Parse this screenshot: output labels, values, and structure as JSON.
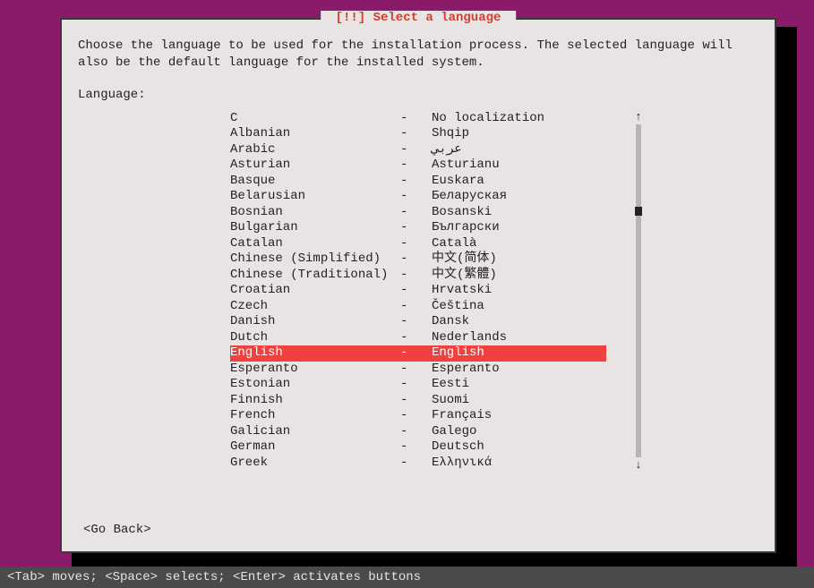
{
  "title": " [!!] Select a language ",
  "instructions": "Choose the language to be used for the installation process. The selected language will also be the default language for the installed system.",
  "label": "Language:",
  "dash": "-",
  "items": [
    {
      "name": "C",
      "native": "No localization"
    },
    {
      "name": "Albanian",
      "native": "Shqip"
    },
    {
      "name": "Arabic",
      "native": "عربي"
    },
    {
      "name": "Asturian",
      "native": "Asturianu"
    },
    {
      "name": "Basque",
      "native": "Euskara"
    },
    {
      "name": "Belarusian",
      "native": "Беларуская"
    },
    {
      "name": "Bosnian",
      "native": "Bosanski"
    },
    {
      "name": "Bulgarian",
      "native": "Български"
    },
    {
      "name": "Catalan",
      "native": "Català"
    },
    {
      "name": "Chinese (Simplified)",
      "native": "中文(简体)"
    },
    {
      "name": "Chinese (Traditional)",
      "native": "中文(繁體)"
    },
    {
      "name": "Croatian",
      "native": "Hrvatski"
    },
    {
      "name": "Czech",
      "native": "Čeština"
    },
    {
      "name": "Danish",
      "native": "Dansk"
    },
    {
      "name": "Dutch",
      "native": "Nederlands"
    },
    {
      "name": "English",
      "native": "English"
    },
    {
      "name": "Esperanto",
      "native": "Esperanto"
    },
    {
      "name": "Estonian",
      "native": "Eesti"
    },
    {
      "name": "Finnish",
      "native": "Suomi"
    },
    {
      "name": "French",
      "native": "Français"
    },
    {
      "name": "Galician",
      "native": "Galego"
    },
    {
      "name": "German",
      "native": "Deutsch"
    },
    {
      "name": "Greek",
      "native": "Ελληνικά"
    }
  ],
  "selected_index": 15,
  "go_back": "<Go Back>",
  "footer": "<Tab> moves; <Space> selects; <Enter> activates buttons",
  "scroll_up": "↑",
  "scroll_down": "↓"
}
